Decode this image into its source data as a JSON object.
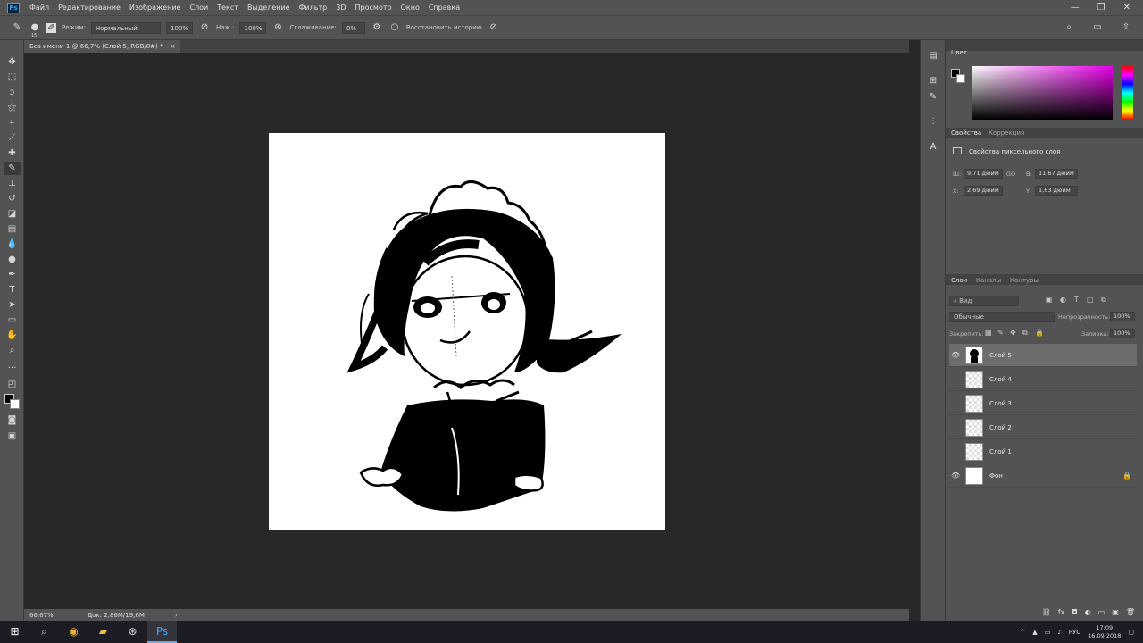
{
  "menubar": {
    "app_logo": "Ps",
    "items": [
      "Файл",
      "Редактирование",
      "Изображение",
      "Слои",
      "Текст",
      "Выделение",
      "Фильтр",
      "3D",
      "Просмотр",
      "Окно",
      "Справка"
    ],
    "minimize": "—",
    "maximize": "❐",
    "close": "✕"
  },
  "options": {
    "brush_size": "15",
    "mode_label": "Режим:",
    "mode_value": "Нормальный",
    "opacity_value": "100%",
    "pressure_label": "Наж.:",
    "pressure_value": "100%",
    "smoothing_label": "Сглаживание:",
    "smoothing_value": "0%",
    "restore_history": "Восстановить историю"
  },
  "document": {
    "tab_title": "Без имени-1 @ 66,7% (Слой 5, RGB/8#) *",
    "tab_close": "×"
  },
  "status": {
    "zoom": "66,67%",
    "doc_info": "Док: 2,86M/19,6M",
    "arrow": "›"
  },
  "color_panel": {
    "title": "Цвет"
  },
  "properties": {
    "tab_active": "Свойства",
    "tab_other": "Коррекция",
    "heading": "Свойства пиксельного слоя",
    "w_label": "Ш:",
    "w_value": "9,71 дюйм",
    "h_label": "В:",
    "h_value": "11,67 дюйм",
    "link": "GO",
    "x_label": "X:",
    "x_value": "2,69 дюйм",
    "y_label": "Y:",
    "y_value": "1,63 дюйм"
  },
  "layers_panel": {
    "tabs": [
      "Слои",
      "Каналы",
      "Контуры"
    ],
    "filter_label": "Вид",
    "blend_mode": "Обычные",
    "opacity_label": "Непрозрачность:",
    "opacity_value": "100%",
    "lock_label": "Закрепить:",
    "fill_label": "Заливка:",
    "fill_value": "100%",
    "layers": [
      {
        "name": "Слой 5",
        "visible": true,
        "selected": true
      },
      {
        "name": "Слой 4",
        "visible": false,
        "selected": false
      },
      {
        "name": "Слой 3",
        "visible": false,
        "selected": false
      },
      {
        "name": "Слой 2",
        "visible": false,
        "selected": false
      },
      {
        "name": "Слой 1",
        "visible": false,
        "selected": false
      },
      {
        "name": "Фон",
        "visible": true,
        "selected": false,
        "locked": true
      }
    ],
    "footer_icons": [
      "fx",
      "◘",
      "◐",
      "▭",
      "▣",
      "🗑"
    ]
  },
  "taskbar": {
    "language": "РУС",
    "time": "17:09",
    "date": "16.09.2018"
  },
  "colors": {
    "ui_dark": "#282828",
    "ui_panel": "#535353",
    "accent": "#31a8ff"
  }
}
